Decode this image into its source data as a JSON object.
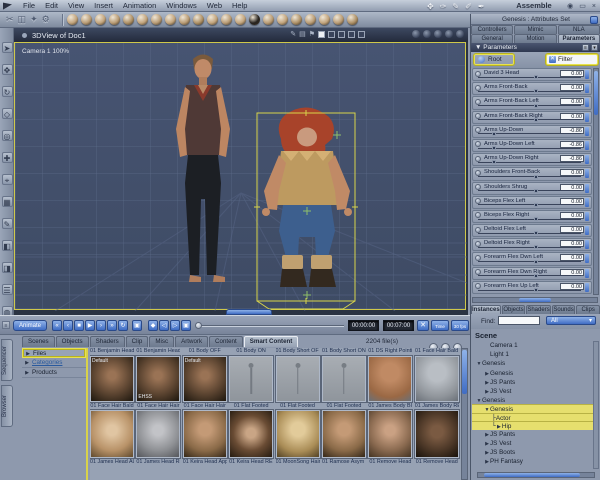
{
  "app": {
    "room_label": "Assemble",
    "menu": [
      "File",
      "Edit",
      "View",
      "Insert",
      "Animation",
      "Windows",
      "Web",
      "Help"
    ],
    "quick_tools": [
      {
        "glyph": "✥",
        "name": "hand-tool-icon"
      },
      {
        "glyph": "✑",
        "name": "pen-tool-icon"
      },
      {
        "glyph": "✎",
        "name": "pencil-tool-icon"
      },
      {
        "glyph": "✐",
        "name": "stylus-tool-icon"
      },
      {
        "glyph": "✒",
        "name": "knife-tool-icon"
      }
    ],
    "window_buttons": [
      {
        "glyph": "◉",
        "name": "eye-icon"
      },
      {
        "glyph": "▭",
        "name": "restore-icon"
      },
      {
        "glyph": "×",
        "name": "close-icon"
      }
    ]
  },
  "toolbar": {
    "file_tools": [
      {
        "glyph": "✂",
        "name": "cut-tool-icon"
      },
      {
        "glyph": "◫",
        "name": "copy-tool-icon"
      },
      {
        "glyph": "✦",
        "name": "paste-tool-icon"
      },
      {
        "glyph": "⚙",
        "name": "settings-tool-icon"
      }
    ],
    "primitive_knobs": [
      "#c2a47c",
      "#b89b74",
      "#c2a47c",
      "#b89b74",
      "#ad9066",
      "#c2a47c",
      "#b89b74",
      "#c2a47c",
      "#b89b74",
      "#ad9066",
      "#c2a47c",
      "#b89b74",
      "#c2a47c",
      "#26221e",
      "#b89b74",
      "#c2a47c",
      "#ad9066",
      "#b89b74",
      "#c2a47c",
      "#b89b74",
      "#ad9066"
    ]
  },
  "left_toolbar": {
    "tools": [
      {
        "glyph": "➤",
        "name": "select-tool-icon"
      },
      {
        "glyph": "✥",
        "name": "move-tool-icon"
      },
      {
        "glyph": "↻",
        "name": "rotate-tool-icon"
      },
      {
        "glyph": "◇",
        "name": "scale-tool-icon"
      },
      {
        "glyph": "◎",
        "name": "camera-orbit-tool-icon"
      },
      {
        "glyph": "✚",
        "name": "camera-pan-tool-icon"
      },
      {
        "glyph": "⌖",
        "name": "camera-track-tool-icon"
      },
      {
        "glyph": "▦",
        "name": "grid-tool-icon"
      },
      {
        "glyph": "✎",
        "name": "paint-tool-icon"
      },
      {
        "glyph": "◧",
        "name": "render-preview-tool-icon"
      },
      {
        "glyph": "◨",
        "name": "shading-mode-tool-icon"
      },
      {
        "glyph": "☰",
        "name": "layers-tool-icon"
      },
      {
        "glyph": "◍",
        "name": "magnify-tool-icon"
      }
    ]
  },
  "viewport": {
    "title": "3DView of Doc1",
    "camera_label": "Camera 1 100%",
    "header_misc": [
      {
        "glyph": "✎",
        "name": "annotate-icon"
      },
      {
        "glyph": "▤",
        "name": "ruler-icon"
      },
      {
        "glyph": "⚑",
        "name": "reference-icon"
      }
    ],
    "layout_buttons": [
      "single-view",
      "two-view-horizontal",
      "two-view-vertical",
      "three-view",
      "four-view"
    ],
    "shading_spheres": [
      "wireframe-sphere",
      "flat-sphere",
      "smooth-sphere",
      "textured-sphere"
    ],
    "display_globes": [
      "backdrop-1",
      "backdrop-2",
      "backdrop-3",
      "backdrop-4",
      "backdrop-5"
    ]
  },
  "attributes_panel": {
    "title": "Genesis : Attributes Set",
    "tabs_top": [
      "Controllers",
      "Mimic",
      "NLA"
    ],
    "tabs_bottom": [
      "General",
      "Motion",
      "Parameters"
    ],
    "active_tab": "Parameters",
    "section_label": "▼ Parameters",
    "root_label": "Root",
    "filter_label": "Filter",
    "parameters": [
      {
        "name": "David 3 Head",
        "value": "0.00",
        "pos": 55
      },
      {
        "name": "Arms Front-Back",
        "value": "0.00",
        "pos": 55
      },
      {
        "name": "Arms Front-Back Left",
        "value": "0.00",
        "pos": 55
      },
      {
        "name": "Arms Front-Back Right",
        "value": "0.00",
        "pos": 55
      },
      {
        "name": "Arms Up-Down",
        "value": "-0.86",
        "pos": 14
      },
      {
        "name": "Arms Up-Down Left",
        "value": "-0.86",
        "pos": 14
      },
      {
        "name": "Arms Up-Down Right",
        "value": "-0.86",
        "pos": 14
      },
      {
        "name": "Shoulders Front-Back",
        "value": "0.00",
        "pos": 55
      },
      {
        "name": "Shoulders Shrug",
        "value": "0.00",
        "pos": 55
      },
      {
        "name": "Biceps Flex Left",
        "value": "0.00",
        "pos": 55
      },
      {
        "name": "Biceps Flex Right",
        "value": "0.00",
        "pos": 55
      },
      {
        "name": "Deltoid Flex Left",
        "value": "0.00",
        "pos": 55
      },
      {
        "name": "Deltoid Flex Right",
        "value": "0.00",
        "pos": 55
      },
      {
        "name": "Forearm Flex Dwn Left",
        "value": "0.00",
        "pos": 55
      },
      {
        "name": "Forearm Flex Dwn Right",
        "value": "0.00",
        "pos": 55
      },
      {
        "name": "Forearm Flex Up Left",
        "value": "0.00",
        "pos": 55
      }
    ]
  },
  "instances_panel": {
    "tabs": [
      "Instances",
      "Objects",
      "Shaders",
      "Sounds",
      "Clips"
    ],
    "active_tab": "Instances",
    "find_label": "Find:",
    "find_value": "",
    "find_filter": "All",
    "header": "Scene",
    "tree": [
      {
        "label": "Camera 1",
        "level": 1,
        "state": "leaf",
        "highlight": false
      },
      {
        "label": "Light 1",
        "level": 1,
        "state": "leaf",
        "highlight": false
      },
      {
        "label": "Genesis",
        "level": 0,
        "state": "expanded",
        "highlight": false
      },
      {
        "label": "Genesis",
        "level": 1,
        "state": "collapsed",
        "highlight": false
      },
      {
        "label": "JS Pants",
        "level": 1,
        "state": "collapsed",
        "highlight": false
      },
      {
        "label": "JS Vest",
        "level": 1,
        "state": "collapsed",
        "highlight": false
      },
      {
        "label": "Genesis",
        "level": 0,
        "state": "expanded",
        "highlight": false
      },
      {
        "label": "Genesis",
        "level": 1,
        "state": "expanded",
        "highlight": true
      },
      {
        "label": "Actor",
        "level": 2,
        "state": "leaf",
        "highlight": true,
        "connector": "mid"
      },
      {
        "label": "Hip",
        "level": 2,
        "state": "collapsed",
        "highlight": true,
        "connector": "end"
      },
      {
        "label": "JS Pants",
        "level": 1,
        "state": "collapsed",
        "highlight": false
      },
      {
        "label": "JS Vest",
        "level": 1,
        "state": "collapsed",
        "highlight": false
      },
      {
        "label": "JS Boots",
        "level": 1,
        "state": "collapsed",
        "highlight": false
      },
      {
        "label": "PH Fantasy",
        "level": 1,
        "state": "collapsed",
        "highlight": false
      }
    ]
  },
  "timeline": {
    "animate_label": "Animate",
    "transport": [
      {
        "glyph": "«",
        "name": "go-start-button"
      },
      {
        "glyph": "‹",
        "name": "prev-frame-button"
      },
      {
        "glyph": "■",
        "name": "stop-button"
      },
      {
        "glyph": "▶",
        "name": "play-button"
      },
      {
        "glyph": "›",
        "name": "next-frame-button"
      },
      {
        "glyph": "»",
        "name": "go-end-button"
      },
      {
        "glyph": "↻",
        "name": "loop-button"
      }
    ],
    "record_button": {
      "glyph": "▣",
      "name": "record-keyframe-button"
    },
    "key_buttons": [
      {
        "glyph": "◆",
        "name": "add-key-button"
      },
      {
        "glyph": "◁",
        "name": "prev-key-button"
      },
      {
        "glyph": "▷",
        "name": "next-key-button"
      },
      {
        "glyph": "▣",
        "name": "delete-key-button"
      }
    ],
    "time_current": "00:00:00",
    "time_end": "00:07:00",
    "clear_button": "✕",
    "mode_label": "Time",
    "fps_label": "30 fps"
  },
  "browser": {
    "side_tabs": [
      "Sequencer",
      "Browser"
    ],
    "tabs": [
      "Scenes",
      "Objects",
      "Shaders",
      "Clip",
      "Misc",
      "Artwork",
      "Content",
      "Smart Content"
    ],
    "active_tab": "Smart Content",
    "file_count": "2204 file(s)",
    "nav": [
      {
        "label": "Files",
        "style": "selected"
      },
      {
        "label": "Categories",
        "style": "link"
      },
      {
        "label": "Products",
        "style": "normal"
      }
    ],
    "partial_row_labels": [
      "01 Benjamin Head IN",
      "01 Benjamin Head R",
      "01 Body OFF",
      "01 Body ON",
      "01 Body Short OFF",
      "01 Body Short ON",
      "01 DS Right Pointing",
      "01 Face Hair Bald"
    ],
    "rows": [
      {
        "items": [
          {
            "label": "01 Face Hair Bald",
            "tone": "face_dark",
            "tag": "Default",
            "tag_pos": "tl"
          },
          {
            "label": "01 Face Hair Hair",
            "tone": "face_dark",
            "tag": "EHSS",
            "tag_pos": "bl"
          },
          {
            "label": "01 Face Hair Hair",
            "tone": "face_dark",
            "tag": "Default",
            "tag_pos": "tl"
          },
          {
            "label": "01 Flat Footed",
            "tone": "skeleton",
            "tag": "",
            "tag_pos": ""
          },
          {
            "label": "01 Flat Footed",
            "tone": "skeleton",
            "tag": "",
            "tag_pos": ""
          },
          {
            "label": "01 Flat Footed",
            "tone": "skeleton",
            "tag": "",
            "tag_pos": ""
          },
          {
            "label": "01 James Body BU",
            "tone": "body_tan",
            "tag": "",
            "tag_pos": ""
          },
          {
            "label": "01 James Body REM",
            "tone": "body_gray",
            "tag": "",
            "tag_pos": ""
          }
        ]
      },
      {
        "items": [
          {
            "label": "01 James Head AU",
            "tone": "face_light",
            "tag": "",
            "tag_pos": ""
          },
          {
            "label": "01 James Head REM",
            "tone": "head_gray",
            "tag": "",
            "tag_pos": ""
          },
          {
            "label": "01 Keira Head Apply",
            "tone": "head_bald",
            "tag": "",
            "tag_pos": ""
          },
          {
            "label": "01 Keira Head REM",
            "tone": "face_brunette",
            "tag": "",
            "tag_pos": ""
          },
          {
            "label": "01 MoonSong Hair",
            "tone": "hair_blonde",
            "tag": "",
            "tag_pos": ""
          },
          {
            "label": "01 Ramose Asym H",
            "tone": "head_bald",
            "tag": "",
            "tag_pos": ""
          },
          {
            "label": "01 Remove Head",
            "tone": "head_tan",
            "tag": "",
            "tag_pos": ""
          },
          {
            "label": "01 Remove Head",
            "tone": "face_dark2",
            "tag": "",
            "tag_pos": ""
          }
        ]
      }
    ]
  },
  "colors": {
    "selection_yellow": "#e8e24e",
    "accent_blue": "#3f6cc4",
    "viewport_background": "#44516b",
    "highlight_row": "#e6df6e"
  }
}
